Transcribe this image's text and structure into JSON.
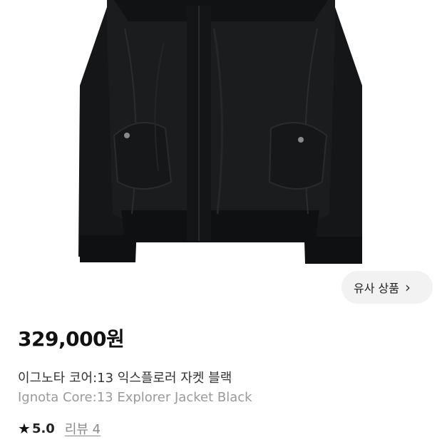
{
  "similar_button": {
    "label": "유사 상품",
    "chevron": "›"
  },
  "product": {
    "price": "329,000원",
    "name_ko": "이그노타 코어:13 익스플로러 자켓 블랙",
    "name_en": "Ignota Core:13 Explorer Jacket Black"
  },
  "rating": {
    "star_icon": "★",
    "score": "5.0",
    "review_link": "리뷰 4"
  }
}
